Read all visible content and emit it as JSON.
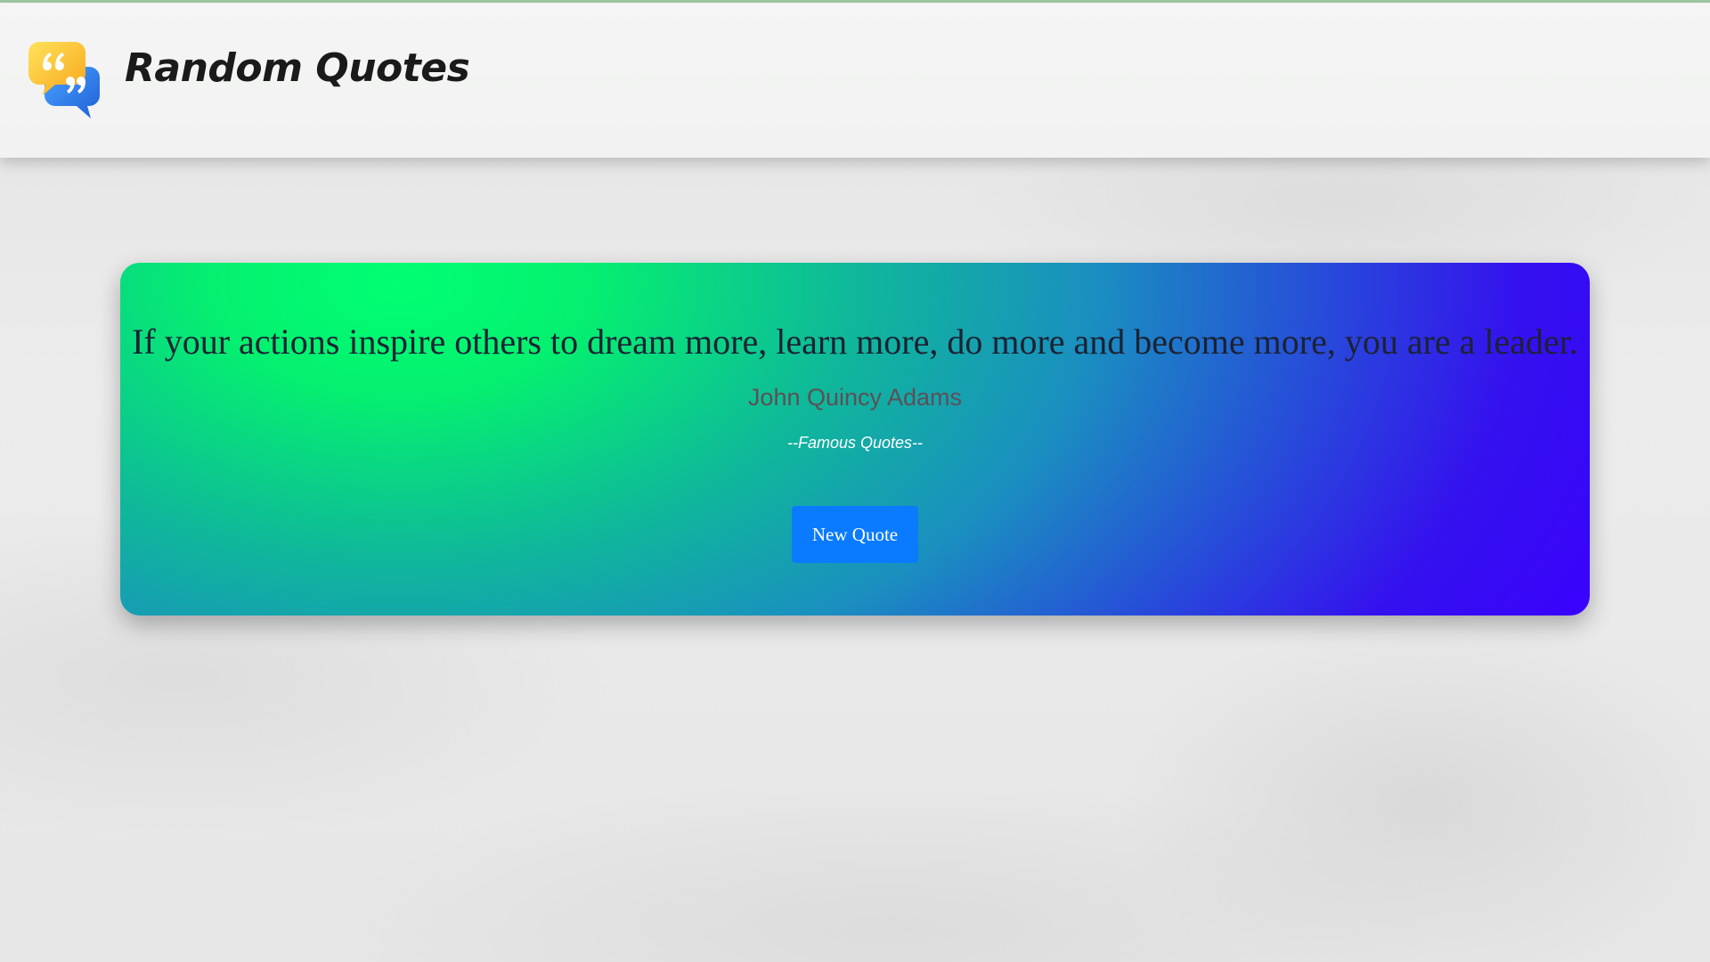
{
  "header": {
    "title": "Random Quotes",
    "logo_icon": "quote-speech-bubbles-icon"
  },
  "quote": {
    "text": "If your actions inspire others to dream more, learn more, do more and become more, you are a leader.",
    "author": "John Quincy Adams",
    "source": "--Famous Quotes--"
  },
  "actions": {
    "new_quote_label": "New Quote"
  },
  "colors": {
    "gradient_start": "#00ff72",
    "gradient_end": "#3a00ff",
    "button": "#0a7bff"
  }
}
